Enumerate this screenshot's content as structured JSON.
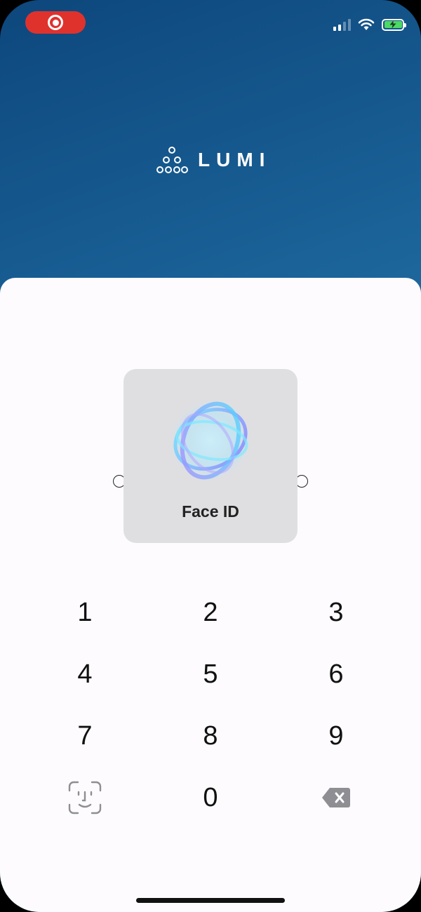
{
  "app": {
    "brand": "LUMI"
  },
  "status_bar": {
    "recording_icon": "screen-recording-icon",
    "signal_icon": "cellular-signal-icon",
    "wifi_icon": "wifi-icon",
    "battery_icon": "battery-charging-icon",
    "accent_recording": "#e0322d",
    "battery_color": "#4cd964"
  },
  "faceid_popup": {
    "label": "Face ID",
    "icon": "face-id-scanning-icon"
  },
  "keypad": {
    "keys": [
      "1",
      "2",
      "3",
      "4",
      "5",
      "6",
      "7",
      "8",
      "9",
      "0"
    ],
    "faceid_key_icon": "face-id-icon",
    "delete_key_icon": "delete-backspace-icon"
  },
  "colors": {
    "header_gradient_start": "#0d477c",
    "header_gradient_end": "#3a9ccb",
    "sheet_background": "#fdfbfe"
  }
}
